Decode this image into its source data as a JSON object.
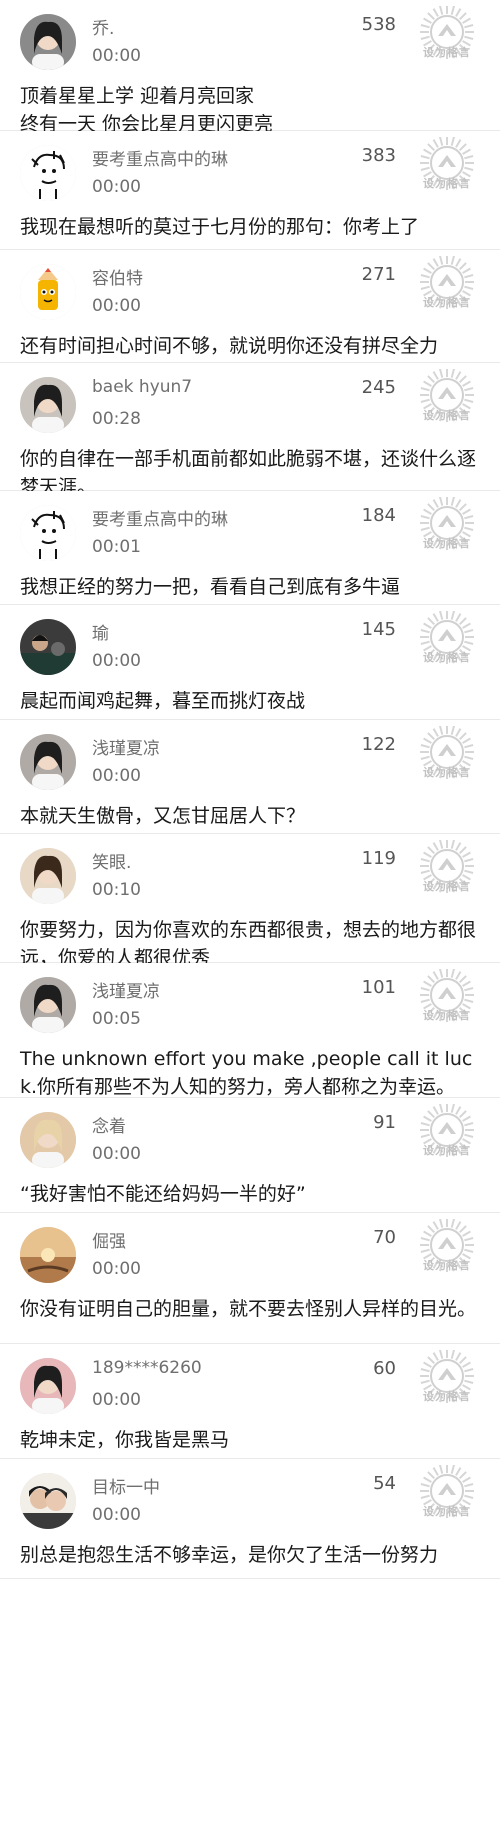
{
  "stamp_label": "设为格言",
  "items": [
    {
      "username": "乔.",
      "time": "00:00",
      "likes": "538",
      "quote": "顶着星星上学 迎着月亮回家\n终有一天 你会比星月更闪更亮",
      "avatar_icon": "girl-photo-avatar",
      "avatar_color": "#8a8a8a"
    },
    {
      "username": "要考重点高中的琳",
      "time": "00:00",
      "likes": "383",
      "quote": "我现在最想听的莫过于七月份的那句：你考上了",
      "avatar_icon": "cartoon-sketch-avatar",
      "avatar_color": "#ffffff"
    },
    {
      "username": "容伯特",
      "time": "00:00",
      "likes": "271",
      "quote": "还有时间担心时间不够，就说明你还没有拼尽全力",
      "avatar_icon": "pencil-cartoon-avatar",
      "avatar_color": "#f4b400"
    },
    {
      "username": "baek hyun7",
      "time": "00:28",
      "likes": "245",
      "quote": "你的自律在一部手机面前都如此脆弱不堪，还谈什么逐梦天涯。",
      "avatar_icon": "boy-photo-avatar",
      "avatar_color": "#c9c3bd"
    },
    {
      "username": "要考重点高中的琳",
      "time": "00:01",
      "likes": "184",
      "quote": "我想正经的努力一把，看看自己到底有多牛逼",
      "avatar_icon": "cartoon-sketch-avatar",
      "avatar_color": "#ffffff"
    },
    {
      "username": "瑜",
      "time": "00:00",
      "likes": "145",
      "quote": "晨起而闻鸡起舞，暮至而挑灯夜战",
      "avatar_icon": "dark-photo-avatar",
      "avatar_color": "#3b3b3b"
    },
    {
      "username": "浅瑾夏凉",
      "time": "00:00",
      "likes": "122",
      "quote": "本就天生傲骨，又怎甘屈居人下？",
      "avatar_icon": "girl-photo-avatar",
      "avatar_color": "#b0aaa6"
    },
    {
      "username": "笑眼.",
      "time": "00:10",
      "likes": "119",
      "quote": "你要努力，因为你喜欢的东西都很贵，想去的地方都很远，你爱的人都很优秀",
      "avatar_icon": "illustration-girl-avatar",
      "avatar_color": "#e8d9c6"
    },
    {
      "username": "浅瑾夏凉",
      "time": "00:05",
      "likes": "101",
      "quote": "The unknown effort you make ,people call it luck.你所有那些不为人知的努力，旁人都称之为幸运。",
      "avatar_icon": "girl-photo-avatar",
      "avatar_color": "#b0aaa6"
    },
    {
      "username": "念着",
      "time": "00:00",
      "likes": "91",
      "quote": "“我好害怕不能还给妈妈一半的好”",
      "avatar_icon": "blonde-girl-avatar",
      "avatar_color": "#e3c9a8"
    },
    {
      "username": "倔强",
      "time": "00:00",
      "likes": "70",
      "quote": "你没有证明自己的胆量，就不要去怪别人异样的目光。",
      "avatar_icon": "sunset-photo-avatar",
      "avatar_color": "#d9a46a"
    },
    {
      "username": "189****6260",
      "time": "00:00",
      "likes": "60",
      "quote": "乾坤未定，你我皆是黑马",
      "avatar_icon": "girl-photo-avatar",
      "avatar_color": "#e7b7b9"
    },
    {
      "username": "目标一中",
      "time": "00:00",
      "likes": "54",
      "quote": "别总是抱怨生活不够幸运，是你欠了生活一份努力",
      "avatar_icon": "couple-photo-avatar",
      "avatar_color": "#5a5a5a"
    }
  ]
}
